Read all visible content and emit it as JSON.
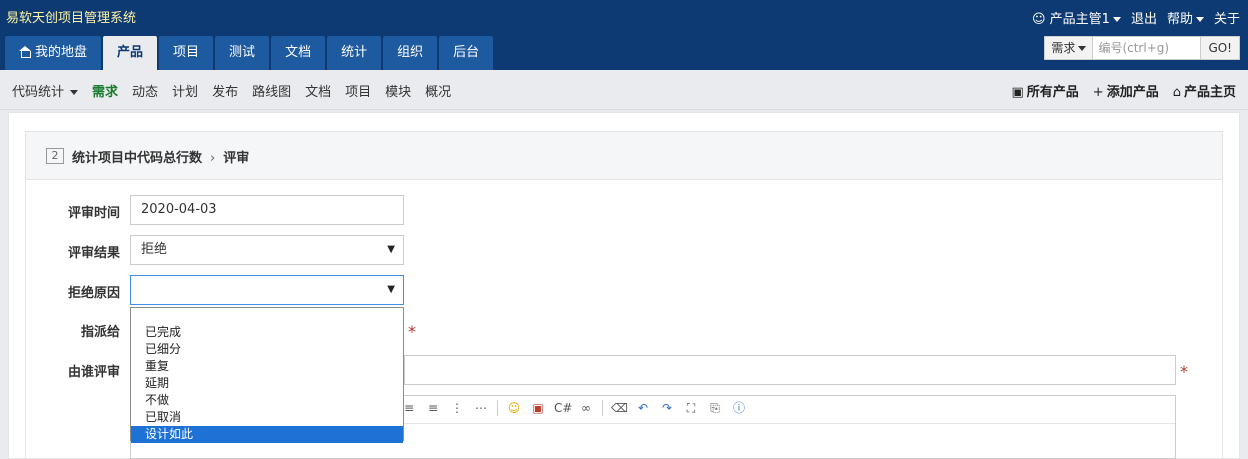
{
  "app": {
    "title": "易软天创项目管理系统"
  },
  "user_menu": {
    "user": "产品主管1",
    "logout": "退出",
    "help": "帮助",
    "about": "关于"
  },
  "nav": {
    "tabs": [
      "我的地盘",
      "产品",
      "项目",
      "测试",
      "文档",
      "统计",
      "组织",
      "后台"
    ],
    "active": "产品"
  },
  "search": {
    "type": "需求",
    "placeholder": "编号(ctrl+g)",
    "go": "GO!"
  },
  "subnav": {
    "left": [
      "代码统计",
      "需求",
      "动态",
      "计划",
      "发布",
      "路线图",
      "文档",
      "项目",
      "模块",
      "概况"
    ],
    "active": "需求",
    "right": [
      "所有产品",
      "添加产品",
      "产品主页"
    ]
  },
  "panel": {
    "id": "2",
    "story_title": "统计项目中代码总行数",
    "action": "评审"
  },
  "form": {
    "review_date_label": "评审时间",
    "review_date_value": "2020-04-03",
    "review_result_label": "评审结果",
    "review_result_value": "拒绝",
    "reject_reason_label": "拒绝原因",
    "reject_reason_value": "",
    "assign_to_label": "指派给",
    "reviewer_label": "由谁评审"
  },
  "reject_reason_options": [
    "",
    "已完成",
    "已细分",
    "重复",
    "延期",
    "不做",
    "已取消",
    "设计如此"
  ],
  "reject_reason_highlighted": "设计如此",
  "colors": {
    "header": "#0e3a73",
    "tab": "#1e5aa0",
    "accent_green": "#1a7a2e",
    "selected_option": "#1e72d6"
  }
}
